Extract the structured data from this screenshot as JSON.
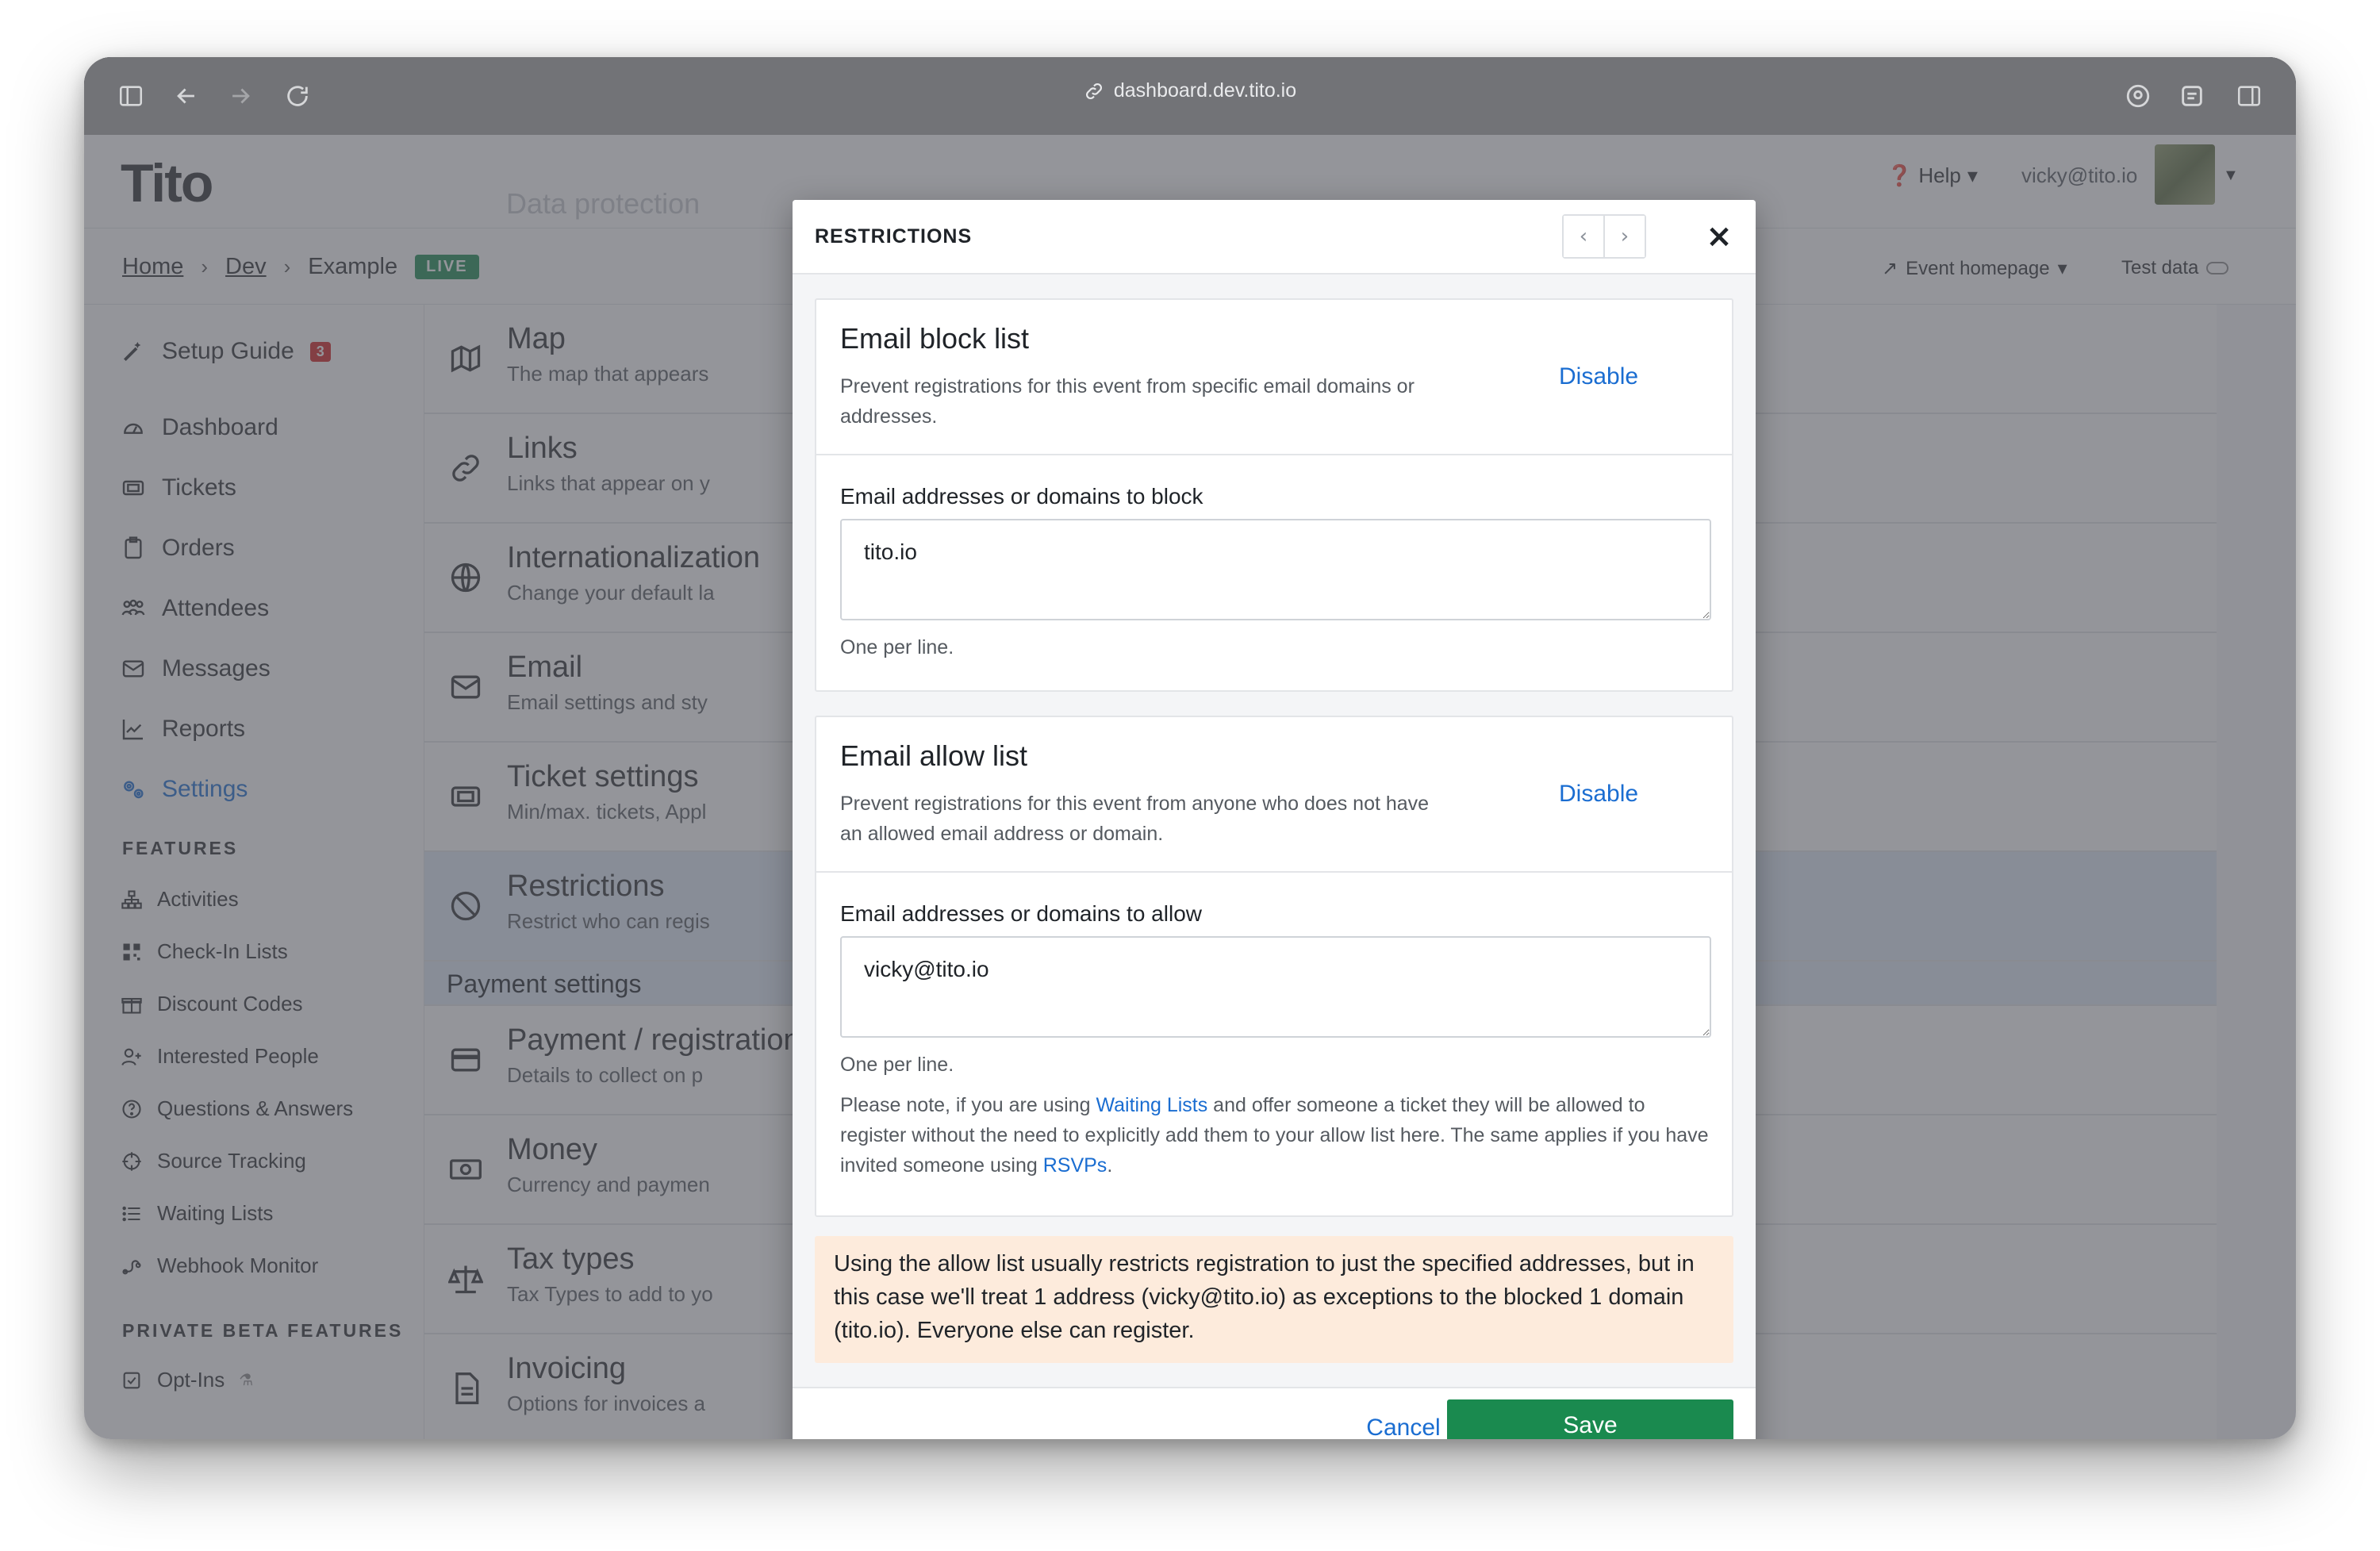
{
  "browser": {
    "url": "dashboard.dev.tito.io"
  },
  "app": {
    "logo": "Tito",
    "ghost_title": "Data protection",
    "help_label": "Help",
    "user_email": "vicky@tito.io",
    "breadcrumbs": [
      "Home",
      "Dev",
      "Example"
    ],
    "live_badge": "LIVE",
    "event_homepage_label": "Event homepage",
    "test_data_label": "Test data"
  },
  "sidebar": {
    "setup_guide": {
      "label": "Setup Guide",
      "badge": "3"
    },
    "main_items": [
      {
        "label": "Dashboard",
        "icon": "gauge-icon"
      },
      {
        "label": "Tickets",
        "icon": "ticket-icon"
      },
      {
        "label": "Orders",
        "icon": "clipboard-icon"
      },
      {
        "label": "Attendees",
        "icon": "people-icon"
      },
      {
        "label": "Messages",
        "icon": "envelope-icon"
      },
      {
        "label": "Reports",
        "icon": "chart-icon"
      },
      {
        "label": "Settings",
        "icon": "gears-icon",
        "active": true
      }
    ],
    "features_heading": "FEATURES",
    "features": [
      {
        "label": "Activities",
        "icon": "sitemap-icon"
      },
      {
        "label": "Check-In Lists",
        "icon": "qrcode-icon"
      },
      {
        "label": "Discount Codes",
        "icon": "gift-icon"
      },
      {
        "label": "Interested People",
        "icon": "user-plus-icon"
      },
      {
        "label": "Questions & Answers",
        "icon": "question-icon"
      },
      {
        "label": "Source Tracking",
        "icon": "crosshair-icon"
      },
      {
        "label": "Waiting Lists",
        "icon": "list-icon"
      },
      {
        "label": "Webhook Monitor",
        "icon": "webhook-icon"
      }
    ],
    "beta_heading": "PRIVATE BETA FEATURES",
    "beta_features": [
      {
        "label": "Opt-Ins",
        "icon": "checkbox-icon"
      }
    ]
  },
  "settings_rows": [
    {
      "title": "Map",
      "desc": "The map that appears"
    },
    {
      "title": "Links",
      "desc": "Links that appear on y"
    },
    {
      "title": "Internationalization",
      "desc": "Change your default la"
    },
    {
      "title": "Email",
      "desc": "Email settings and sty"
    },
    {
      "title": "Ticket settings",
      "desc": "Min/max. tickets, Appl"
    },
    {
      "title": "Restrictions",
      "desc": "Restrict who can regis"
    },
    {
      "title": "Payment / registration",
      "desc": "Details to collect on p"
    },
    {
      "title": "Money",
      "desc": "Currency and paymen"
    },
    {
      "title": "Tax types",
      "desc": "Tax Types to add to yo"
    },
    {
      "title": "Invoicing",
      "desc": "Options for invoices a"
    }
  ],
  "payment_settings_label": "Payment settings",
  "modal": {
    "title": "RESTRICTIONS",
    "prev_label": "‹",
    "next_label": "›",
    "close_label": "×",
    "block_list": {
      "title": "Email block list",
      "description": "Prevent registrations for this event from specific email domains or addresses.",
      "disable_label": "Disable",
      "field_label": "Email addresses or domains to block",
      "value": "tito.io",
      "help": "One per line."
    },
    "allow_list": {
      "title": "Email allow list",
      "description": "Prevent registrations for this event from anyone who does not have an allowed email address or domain.",
      "disable_label": "Disable",
      "field_label": "Email addresses or domains to allow",
      "value": "vicky@tito.io",
      "help": "One per line.",
      "note_part1": "Please note, if you are using ",
      "note_link1": "Waiting Lists",
      "note_part2": " and offer someone a ticket they will be allowed to register without the need to explicitly add them to your allow list here. The same applies if you have invited someone using ",
      "note_link2": "RSVPs",
      "note_part3": "."
    },
    "alert": "Using the allow list usually restricts registration to just the specified addresses, but in this case we'll treat 1 address (vicky@tito.io) as exceptions to the blocked 1 domain (tito.io). Everyone else can register.",
    "cancel_label": "Cancel",
    "save_label": "Save"
  },
  "colors": {
    "accent": "#1a6dd1",
    "save": "#1a8a4f",
    "alert_bg": "#fdebdc",
    "highlight_row": "#dfe9f7"
  }
}
